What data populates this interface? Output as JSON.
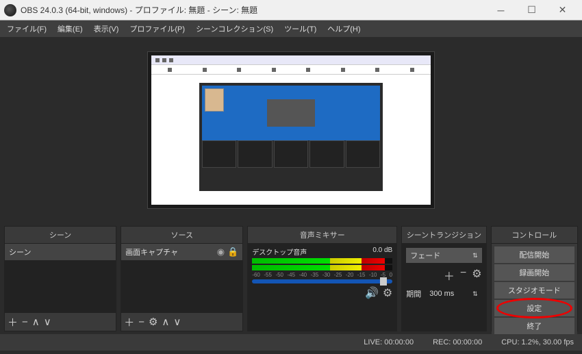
{
  "titlebar": {
    "title": "OBS 24.0.3 (64-bit, windows) - プロファイル: 無題 - シーン: 無題"
  },
  "menubar": {
    "file": "ファイル(F)",
    "edit": "編集(E)",
    "view": "表示(V)",
    "profile": "プロファイル(P)",
    "scenecol": "シーンコレクション(S)",
    "tools": "ツール(T)",
    "help": "ヘルプ(H)"
  },
  "docks": {
    "scenes": {
      "title": "シーン",
      "items": [
        "シーン"
      ]
    },
    "sources": {
      "title": "ソース",
      "items": [
        "画面キャプチャ"
      ]
    },
    "mixer": {
      "title": "音声ミキサー",
      "track_name": "デスクトップ音声",
      "track_db": "0.0 dB",
      "ticks": [
        "-60",
        "-55",
        "-50",
        "-45",
        "-40",
        "-35",
        "-30",
        "-25",
        "-20",
        "-15",
        "-10",
        "-5",
        "0"
      ]
    },
    "transitions": {
      "title": "シーントランジション",
      "selected": "フェード",
      "duration_label": "期間",
      "duration_value": "300 ms"
    },
    "controls": {
      "title": "コントロール",
      "stream": "配信開始",
      "record": "録画開始",
      "studio": "スタジオモード",
      "settings": "設定",
      "exit": "終了"
    }
  },
  "statusbar": {
    "live": "LIVE: 00:00:00",
    "rec": "REC: 00:00:00",
    "cpu": "CPU: 1.2%, 30.00 fps"
  }
}
